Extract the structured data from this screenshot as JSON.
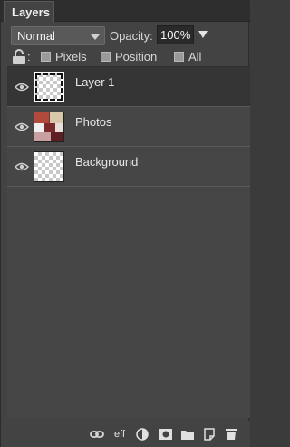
{
  "panel": {
    "tab_label": "Layers"
  },
  "blend": {
    "mode": "Normal"
  },
  "opacity": {
    "label": "Opacity:",
    "value": "100%"
  },
  "lock": {
    "colon": ":",
    "options": [
      "Pixels",
      "Position",
      "All"
    ]
  },
  "layers": [
    {
      "name": "Layer 1",
      "selected": true,
      "visible": true,
      "thumb": "transparent-marquee"
    },
    {
      "name": "Photos",
      "selected": false,
      "visible": true,
      "thumb": "photos"
    },
    {
      "name": "Background",
      "selected": false,
      "visible": true,
      "thumb": "transparent"
    }
  ],
  "footer": {
    "effects_label": "eff",
    "icons": [
      "link-icon",
      "effects-icon",
      "adjustment-icon",
      "mask-icon",
      "folder-icon",
      "new-layer-icon",
      "trash-icon"
    ]
  },
  "colors": {
    "panel": "#434343",
    "selected_row": "#353535",
    "tab_bar": "#2e2e2e"
  }
}
